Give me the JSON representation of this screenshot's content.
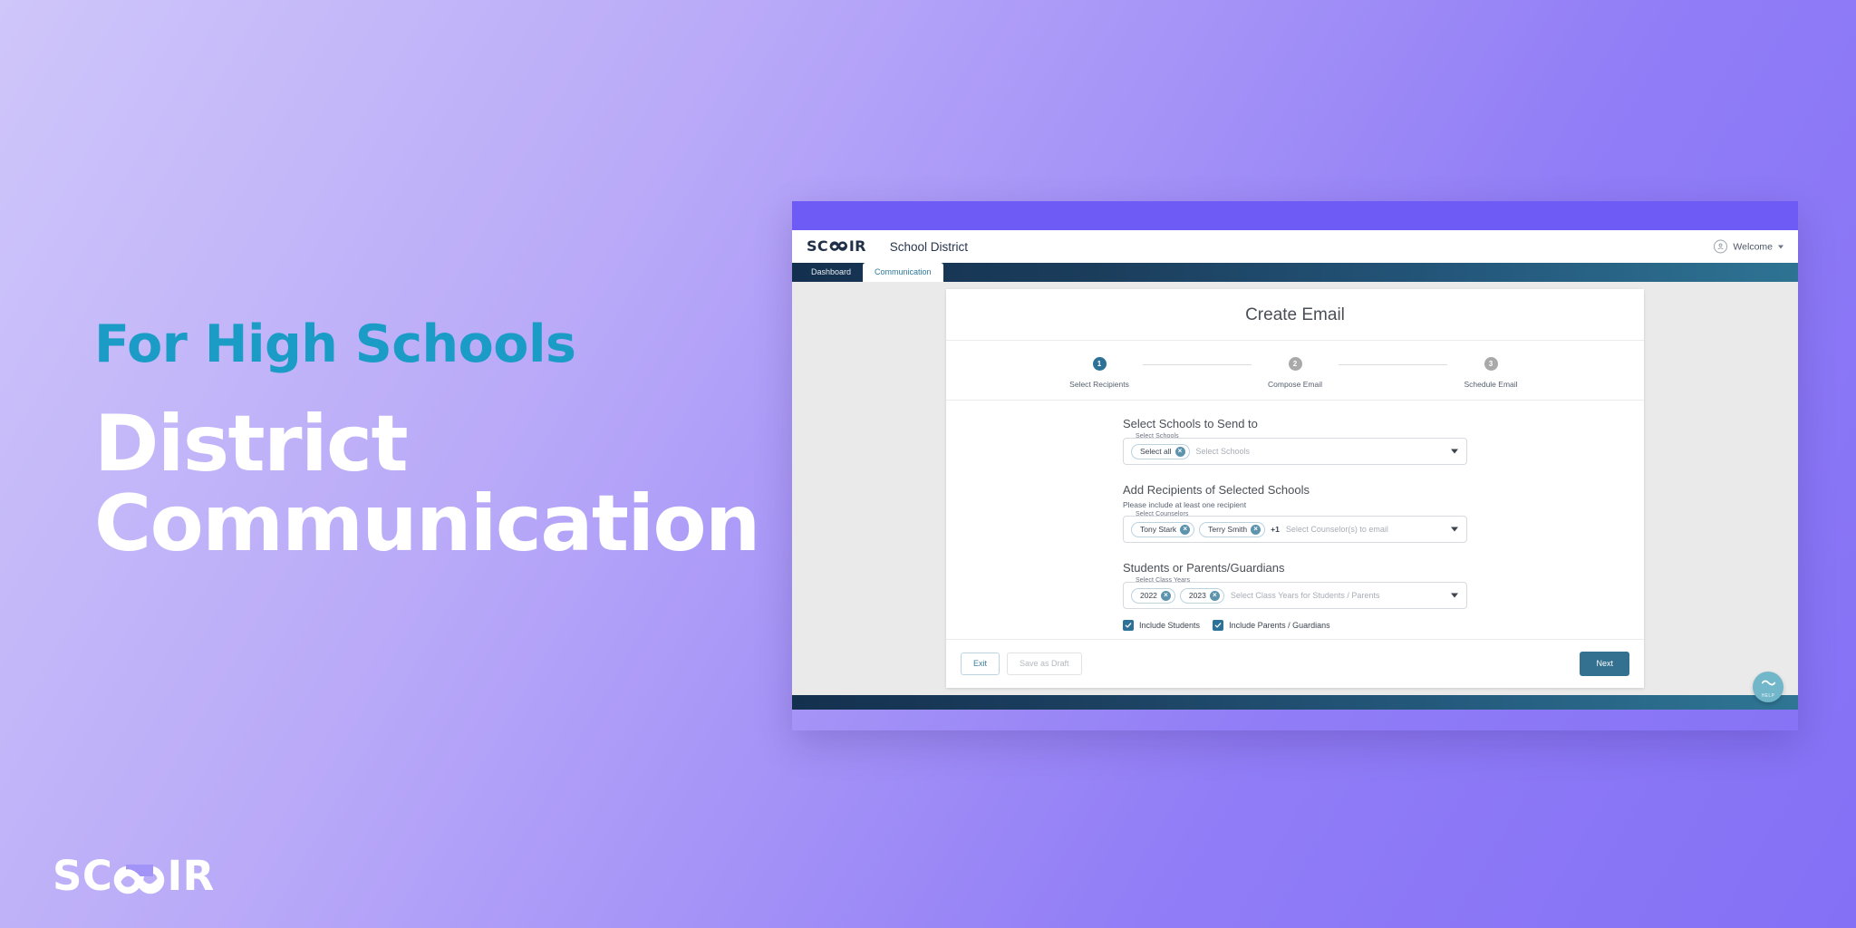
{
  "marketing": {
    "eyebrow": "For High Schools",
    "headline_line1": "District",
    "headline_line2": "Communication",
    "brand_prefix": "SC",
    "brand_suffix": "IR",
    "brand_logo_icon": "scoir-infinity-logo"
  },
  "app": {
    "logo_prefix": "SC",
    "logo_suffix": "IR",
    "title": "School District",
    "welcome_label": "Welcome",
    "avatar_icon": "user-avatar-icon",
    "caret_icon": "chevron-down-icon",
    "nav": [
      {
        "label": "Dashboard",
        "active": false
      },
      {
        "label": "Communication",
        "active": true
      }
    ]
  },
  "card": {
    "title": "Create Email",
    "stepper": [
      {
        "number": "1",
        "label": "Select Recipients",
        "state": "done"
      },
      {
        "number": "2",
        "label": "Compose Email",
        "state": "todo"
      },
      {
        "number": "3",
        "label": "Schedule Email",
        "state": "todo"
      }
    ],
    "sections": {
      "schools": {
        "heading": "Select Schools to Send to",
        "legend": "Select Schools",
        "placeholder": "Select Schools",
        "chips": [
          "Select all"
        ]
      },
      "recipients": {
        "heading": "Add Recipients of Selected Schools",
        "hint": "Please include at least one recipient",
        "legend": "Select Counselors",
        "placeholder": "Select Counselor(s) to email",
        "chips": [
          "Tony Stark",
          "Terry Smith"
        ],
        "overflow": "+1"
      },
      "class_years": {
        "heading": "Students or Parents/Guardians",
        "legend": "Select Class Years",
        "placeholder": "Select Class Years for Students / Parents",
        "chips": [
          "2022",
          "2023"
        ]
      }
    },
    "checkboxes": [
      {
        "label": "Include Students",
        "checked": true
      },
      {
        "label": "Include Parents / Guardians",
        "checked": true
      }
    ],
    "footer": {
      "exit": "Exit",
      "save_draft": "Save as Draft",
      "next": "Next"
    }
  },
  "help": {
    "label": "HELP",
    "icon": "scoir-infinity-icon"
  },
  "colors": {
    "brand_purple": "#6e5bf5",
    "accent_teal": "#1a9cc7",
    "step_active": "#2d7296",
    "step_inactive": "#a9a9a9",
    "primary_button": "#34708f",
    "nav_gradient_start": "#14304f",
    "nav_gradient_end": "#2e7393"
  }
}
